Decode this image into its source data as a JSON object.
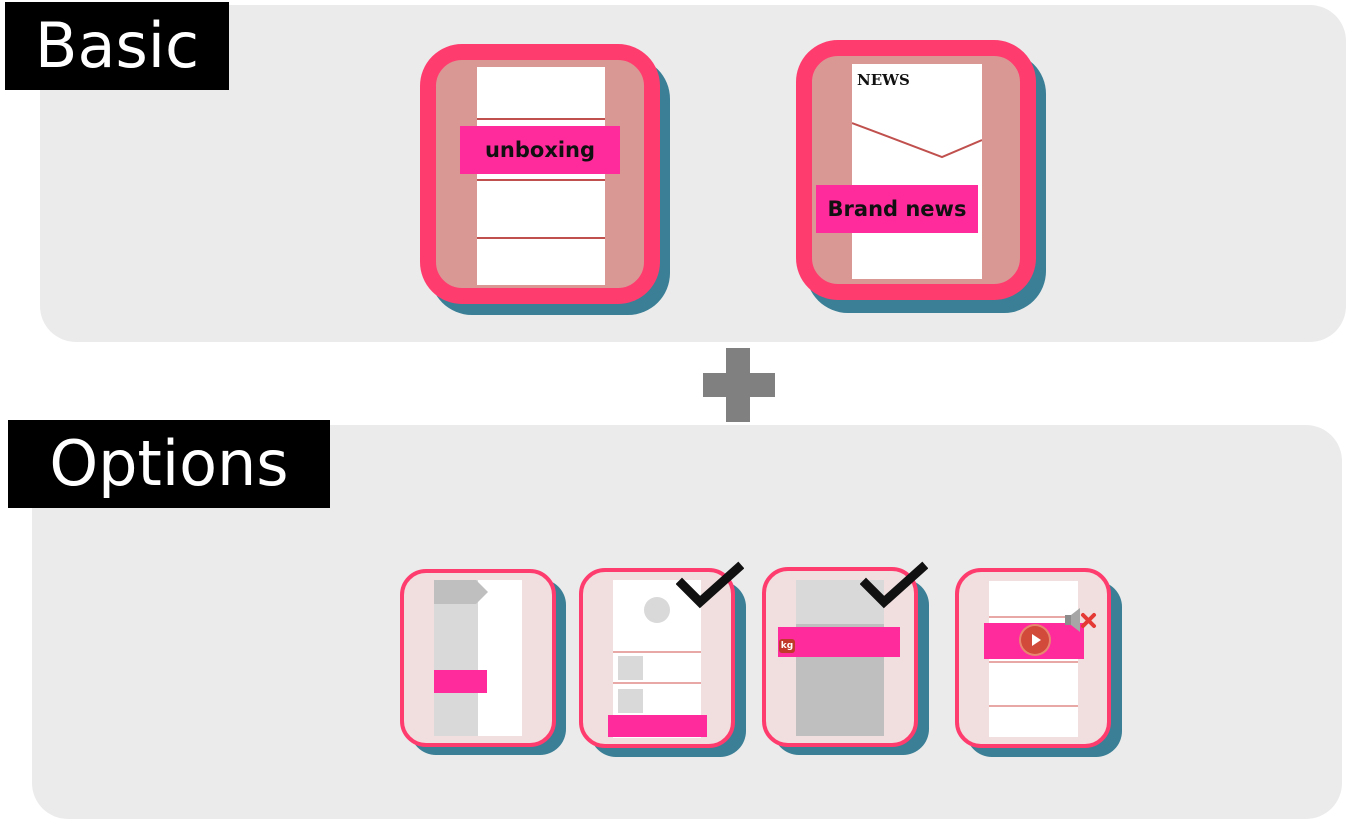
{
  "sections": {
    "basic": {
      "label": "Basic"
    },
    "options": {
      "label": "Options"
    }
  },
  "basic_cards": {
    "unboxing": {
      "label": "unboxing"
    },
    "brand_news": {
      "header": "NEWS",
      "label": "Brand news"
    }
  },
  "option_cards": {
    "card_1": {
      "name": "side-tab-banner"
    },
    "card_2": {
      "name": "profile-list",
      "checked": true
    },
    "card_3": {
      "name": "kakao-banner",
      "checked": true,
      "icon_text": "kg"
    },
    "card_4": {
      "name": "video-banner",
      "muted": true
    }
  },
  "colors": {
    "panel": "#ebebeb",
    "card_border": "#ff3c6e",
    "card_shadow": "#3a7f96",
    "accent_pink": "#ff2a9c",
    "rule_red": "#c0504d"
  }
}
